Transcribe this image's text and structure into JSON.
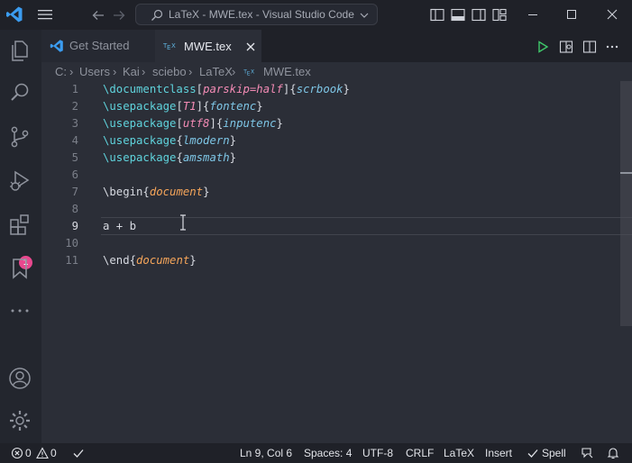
{
  "titlebar": {
    "title": "LaTeX - MWE.tex - Visual Studio Code"
  },
  "activity_bar": {
    "items": [
      "explorer-icon",
      "search-icon",
      "source-control-icon",
      "run-debug-icon",
      "extensions-icon",
      "bookmarks-icon",
      "more-icon",
      "accounts-icon",
      "manage-gear-icon"
    ],
    "extensions_badge": "1"
  },
  "tabs": [
    {
      "label": "Get Started",
      "active": false
    },
    {
      "label": "MWE.tex",
      "active": true
    }
  ],
  "breadcrumb": [
    "C:",
    "Users",
    "Kai",
    "sciebo",
    "LaTeX",
    "MWE.tex"
  ],
  "editor": {
    "lines": [
      {
        "n": "1",
        "tokens": [
          [
            "cmd",
            "\\documentclass"
          ],
          [
            "br",
            "["
          ],
          [
            "opt",
            "parskip=half"
          ],
          [
            "br",
            "]{"
          ],
          [
            "arg",
            "scrbook"
          ],
          [
            "br",
            "}"
          ]
        ]
      },
      {
        "n": "2",
        "tokens": [
          [
            "cmd",
            "\\usepackage"
          ],
          [
            "br",
            "["
          ],
          [
            "opt",
            "T1"
          ],
          [
            "br",
            "]{"
          ],
          [
            "arg",
            "fontenc"
          ],
          [
            "br",
            "}"
          ]
        ]
      },
      {
        "n": "3",
        "tokens": [
          [
            "cmd",
            "\\usepackage"
          ],
          [
            "br",
            "["
          ],
          [
            "opt",
            "utf8"
          ],
          [
            "br",
            "]{"
          ],
          [
            "arg",
            "inputenc"
          ],
          [
            "br",
            "}"
          ]
        ]
      },
      {
        "n": "4",
        "tokens": [
          [
            "cmd",
            "\\usepackage"
          ],
          [
            "br",
            "{"
          ],
          [
            "arg",
            "lmodern"
          ],
          [
            "br",
            "}"
          ]
        ]
      },
      {
        "n": "5",
        "tokens": [
          [
            "cmd",
            "\\usepackage"
          ],
          [
            "br",
            "{"
          ],
          [
            "arg",
            "amsmath"
          ],
          [
            "br",
            "}"
          ]
        ]
      },
      {
        "n": "6",
        "tokens": []
      },
      {
        "n": "7",
        "tokens": [
          [
            "br",
            "\\begin{"
          ],
          [
            "env",
            "document"
          ],
          [
            "br",
            "}"
          ]
        ]
      },
      {
        "n": "8",
        "tokens": []
      },
      {
        "n": "9",
        "tokens": [
          [
            "br",
            "a + b"
          ]
        ]
      },
      {
        "n": "10",
        "tokens": []
      },
      {
        "n": "11",
        "tokens": [
          [
            "br",
            "\\end{"
          ],
          [
            "env",
            "document"
          ],
          [
            "br",
            "}"
          ]
        ]
      }
    ],
    "active_line": "9"
  },
  "statusbar": {
    "errors": "0",
    "warnings": "0",
    "position": "Ln 9, Col 6",
    "spaces": "Spaces: 4",
    "encoding": "UTF-8",
    "eol": "CRLF",
    "language": "LaTeX",
    "mode": "Insert",
    "spell": "Spell"
  },
  "colors": {
    "accent": "#3b9cf0",
    "badge": "#e8488e",
    "command": "#5fd3dc",
    "option": "#f38bb5",
    "argument": "#7ec6e6",
    "environment": "#f5a55a",
    "run": "#3fc76a"
  }
}
